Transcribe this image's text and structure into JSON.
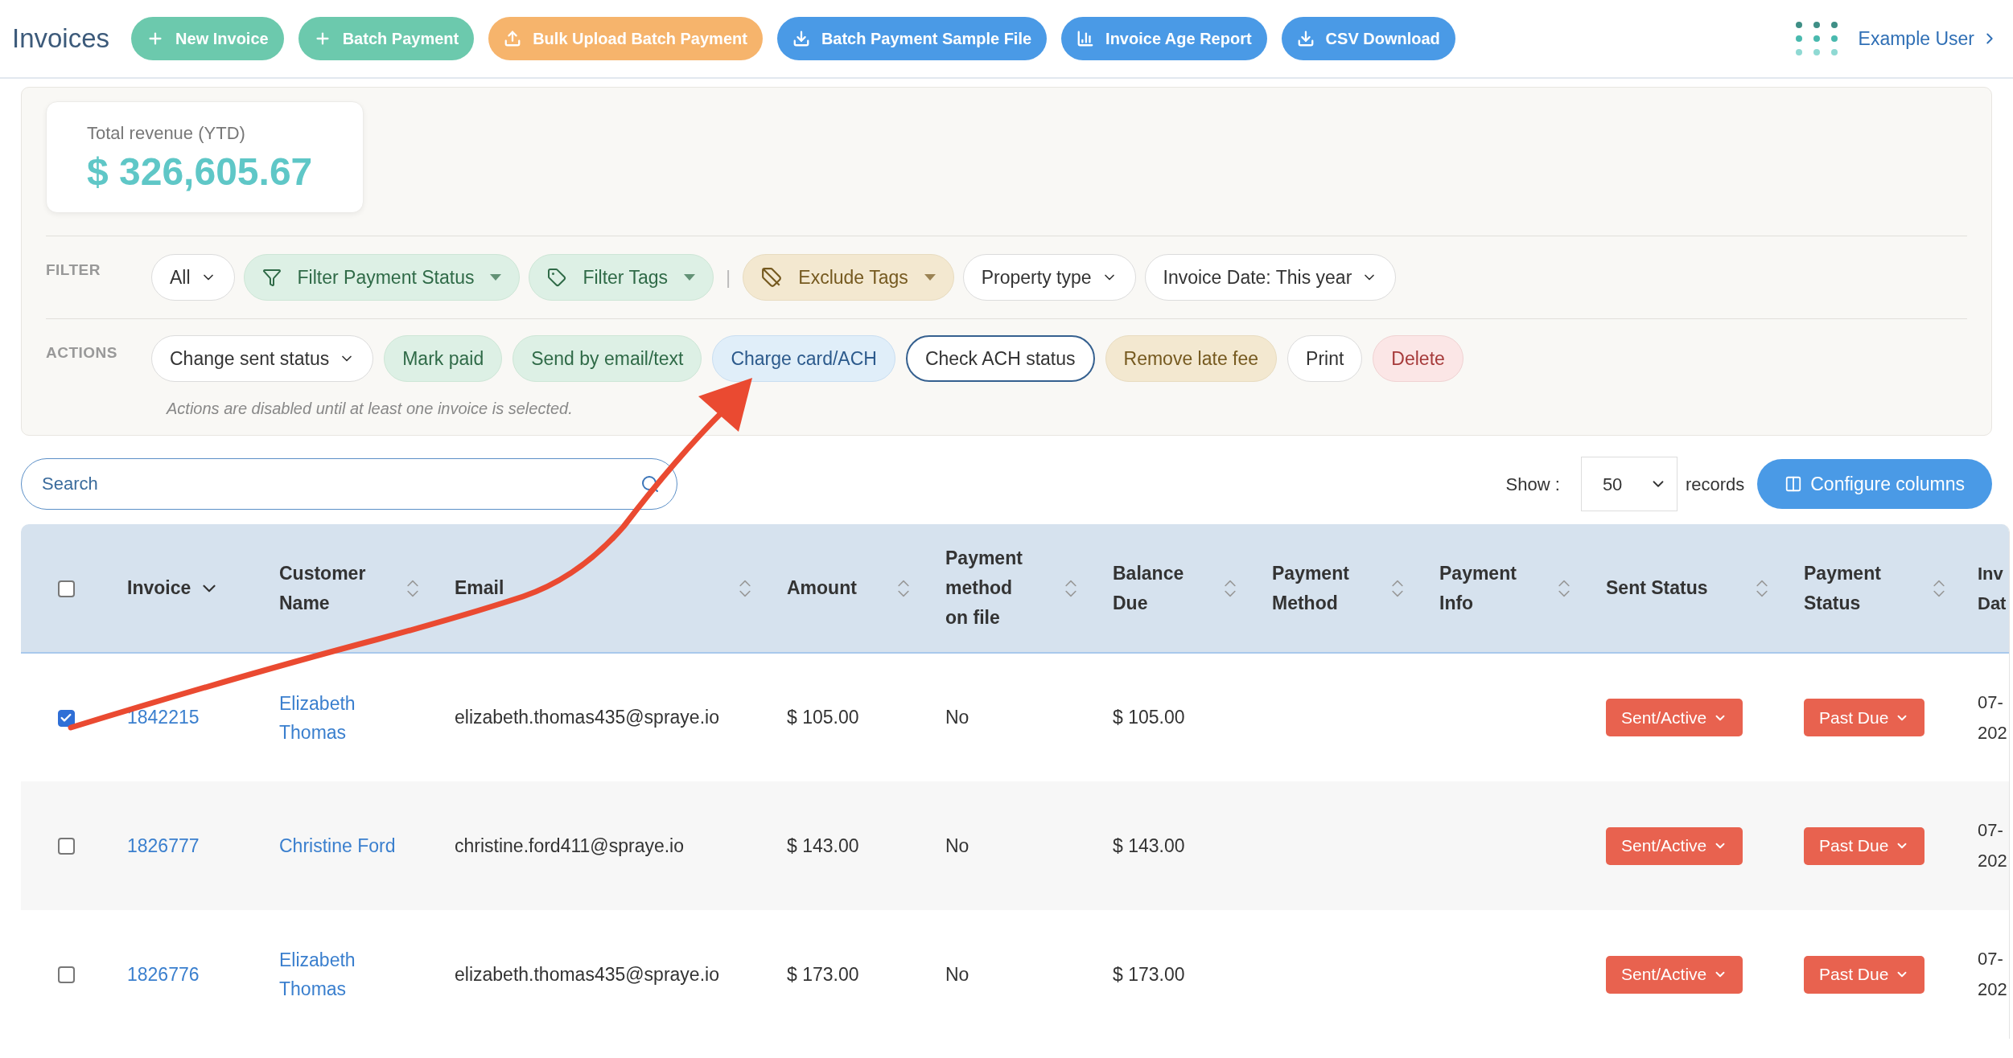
{
  "header": {
    "title": "Invoices",
    "buttons": [
      "New Invoice",
      "Batch Payment",
      "Bulk Upload Batch Payment",
      "Batch Payment Sample File",
      "Invoice Age Report",
      "CSV Download"
    ],
    "user": "Example User"
  },
  "revenue": {
    "label": "Total revenue (YTD)",
    "value": "$ 326,605.67"
  },
  "filter": {
    "label": "FILTER",
    "items": [
      {
        "kind": "dropdown",
        "label": "All"
      },
      {
        "kind": "status",
        "label": "Filter Payment Status"
      },
      {
        "kind": "tags",
        "label": "Filter Tags"
      },
      {
        "kind": "separator",
        "label": "|"
      },
      {
        "kind": "exclude",
        "label": "Exclude Tags"
      },
      {
        "kind": "dropdown",
        "label": "Property type"
      },
      {
        "kind": "dropdown",
        "label": "Invoice Date: This year"
      }
    ]
  },
  "actions": {
    "label": "ACTIONS",
    "items": [
      {
        "kind": "dropdown",
        "label": "Change sent status"
      },
      {
        "kind": "paid",
        "label": "Mark paid"
      },
      {
        "kind": "send",
        "label": "Send by email/text"
      },
      {
        "kind": "charge",
        "label": "Charge card/ACH"
      },
      {
        "kind": "check",
        "label": "Check ACH status"
      },
      {
        "kind": "fee",
        "label": "Remove late fee"
      },
      {
        "kind": "plain",
        "label": "Print"
      },
      {
        "kind": "delete",
        "label": "Delete"
      }
    ],
    "note": "Actions are disabled until at least one invoice is selected."
  },
  "search": {
    "placeholder": "Search"
  },
  "show": {
    "label": "Show :",
    "value": "50",
    "suffix": "records"
  },
  "configure_button": "Configure columns",
  "table": {
    "select_all": {
      "checked": false
    },
    "columns": [
      {
        "lines": [
          "Invoice"
        ],
        "kind": "sorted"
      },
      {
        "lines": [
          "Customer",
          "Name"
        ],
        "kind": "sortable"
      },
      {
        "lines": [
          "Email"
        ],
        "kind": "sortable"
      },
      {
        "lines": [
          "Amount"
        ],
        "kind": "sortable"
      },
      {
        "lines": [
          "Payment",
          "method",
          "on file"
        ],
        "kind": "sortable"
      },
      {
        "lines": [
          "Balance",
          "Due"
        ],
        "kind": "sortable"
      },
      {
        "lines": [
          "Payment",
          "Method"
        ],
        "kind": "sortable"
      },
      {
        "lines": [
          "Payment",
          "Info"
        ],
        "kind": "sortable"
      },
      {
        "lines": [
          "Sent Status"
        ],
        "kind": "sortable"
      },
      {
        "lines": [
          "Payment",
          "Status"
        ],
        "kind": "sortable"
      },
      {
        "lines": [
          "Inv",
          "Dat"
        ],
        "kind": "plain"
      }
    ],
    "rows": [
      {
        "selected": true,
        "invoice": "1842215",
        "customer": "Elizabeth Thomas",
        "email": "elizabeth.thomas435@spraye.io",
        "amount": "$ 105.00",
        "method_on_file": "No",
        "balance": "$ 105.00",
        "sent_status": "Sent/Active",
        "payment_status": "Past Due",
        "date": [
          "07-",
          "202"
        ]
      },
      {
        "selected": false,
        "invoice": "1826777",
        "customer": "Christine Ford",
        "email": "christine.ford411@spraye.io",
        "amount": "$ 143.00",
        "method_on_file": "No",
        "balance": "$ 143.00",
        "sent_status": "Sent/Active",
        "payment_status": "Past Due",
        "date": [
          "07-",
          "202"
        ]
      },
      {
        "selected": false,
        "invoice": "1826776",
        "customer": "Elizabeth Thomas",
        "email": "elizabeth.thomas435@spraye.io",
        "amount": "$ 173.00",
        "method_on_file": "No",
        "balance": "$ 173.00",
        "sent_status": "Sent/Active",
        "payment_status": "Past Due",
        "date": [
          "07-",
          "202"
        ]
      }
    ]
  }
}
